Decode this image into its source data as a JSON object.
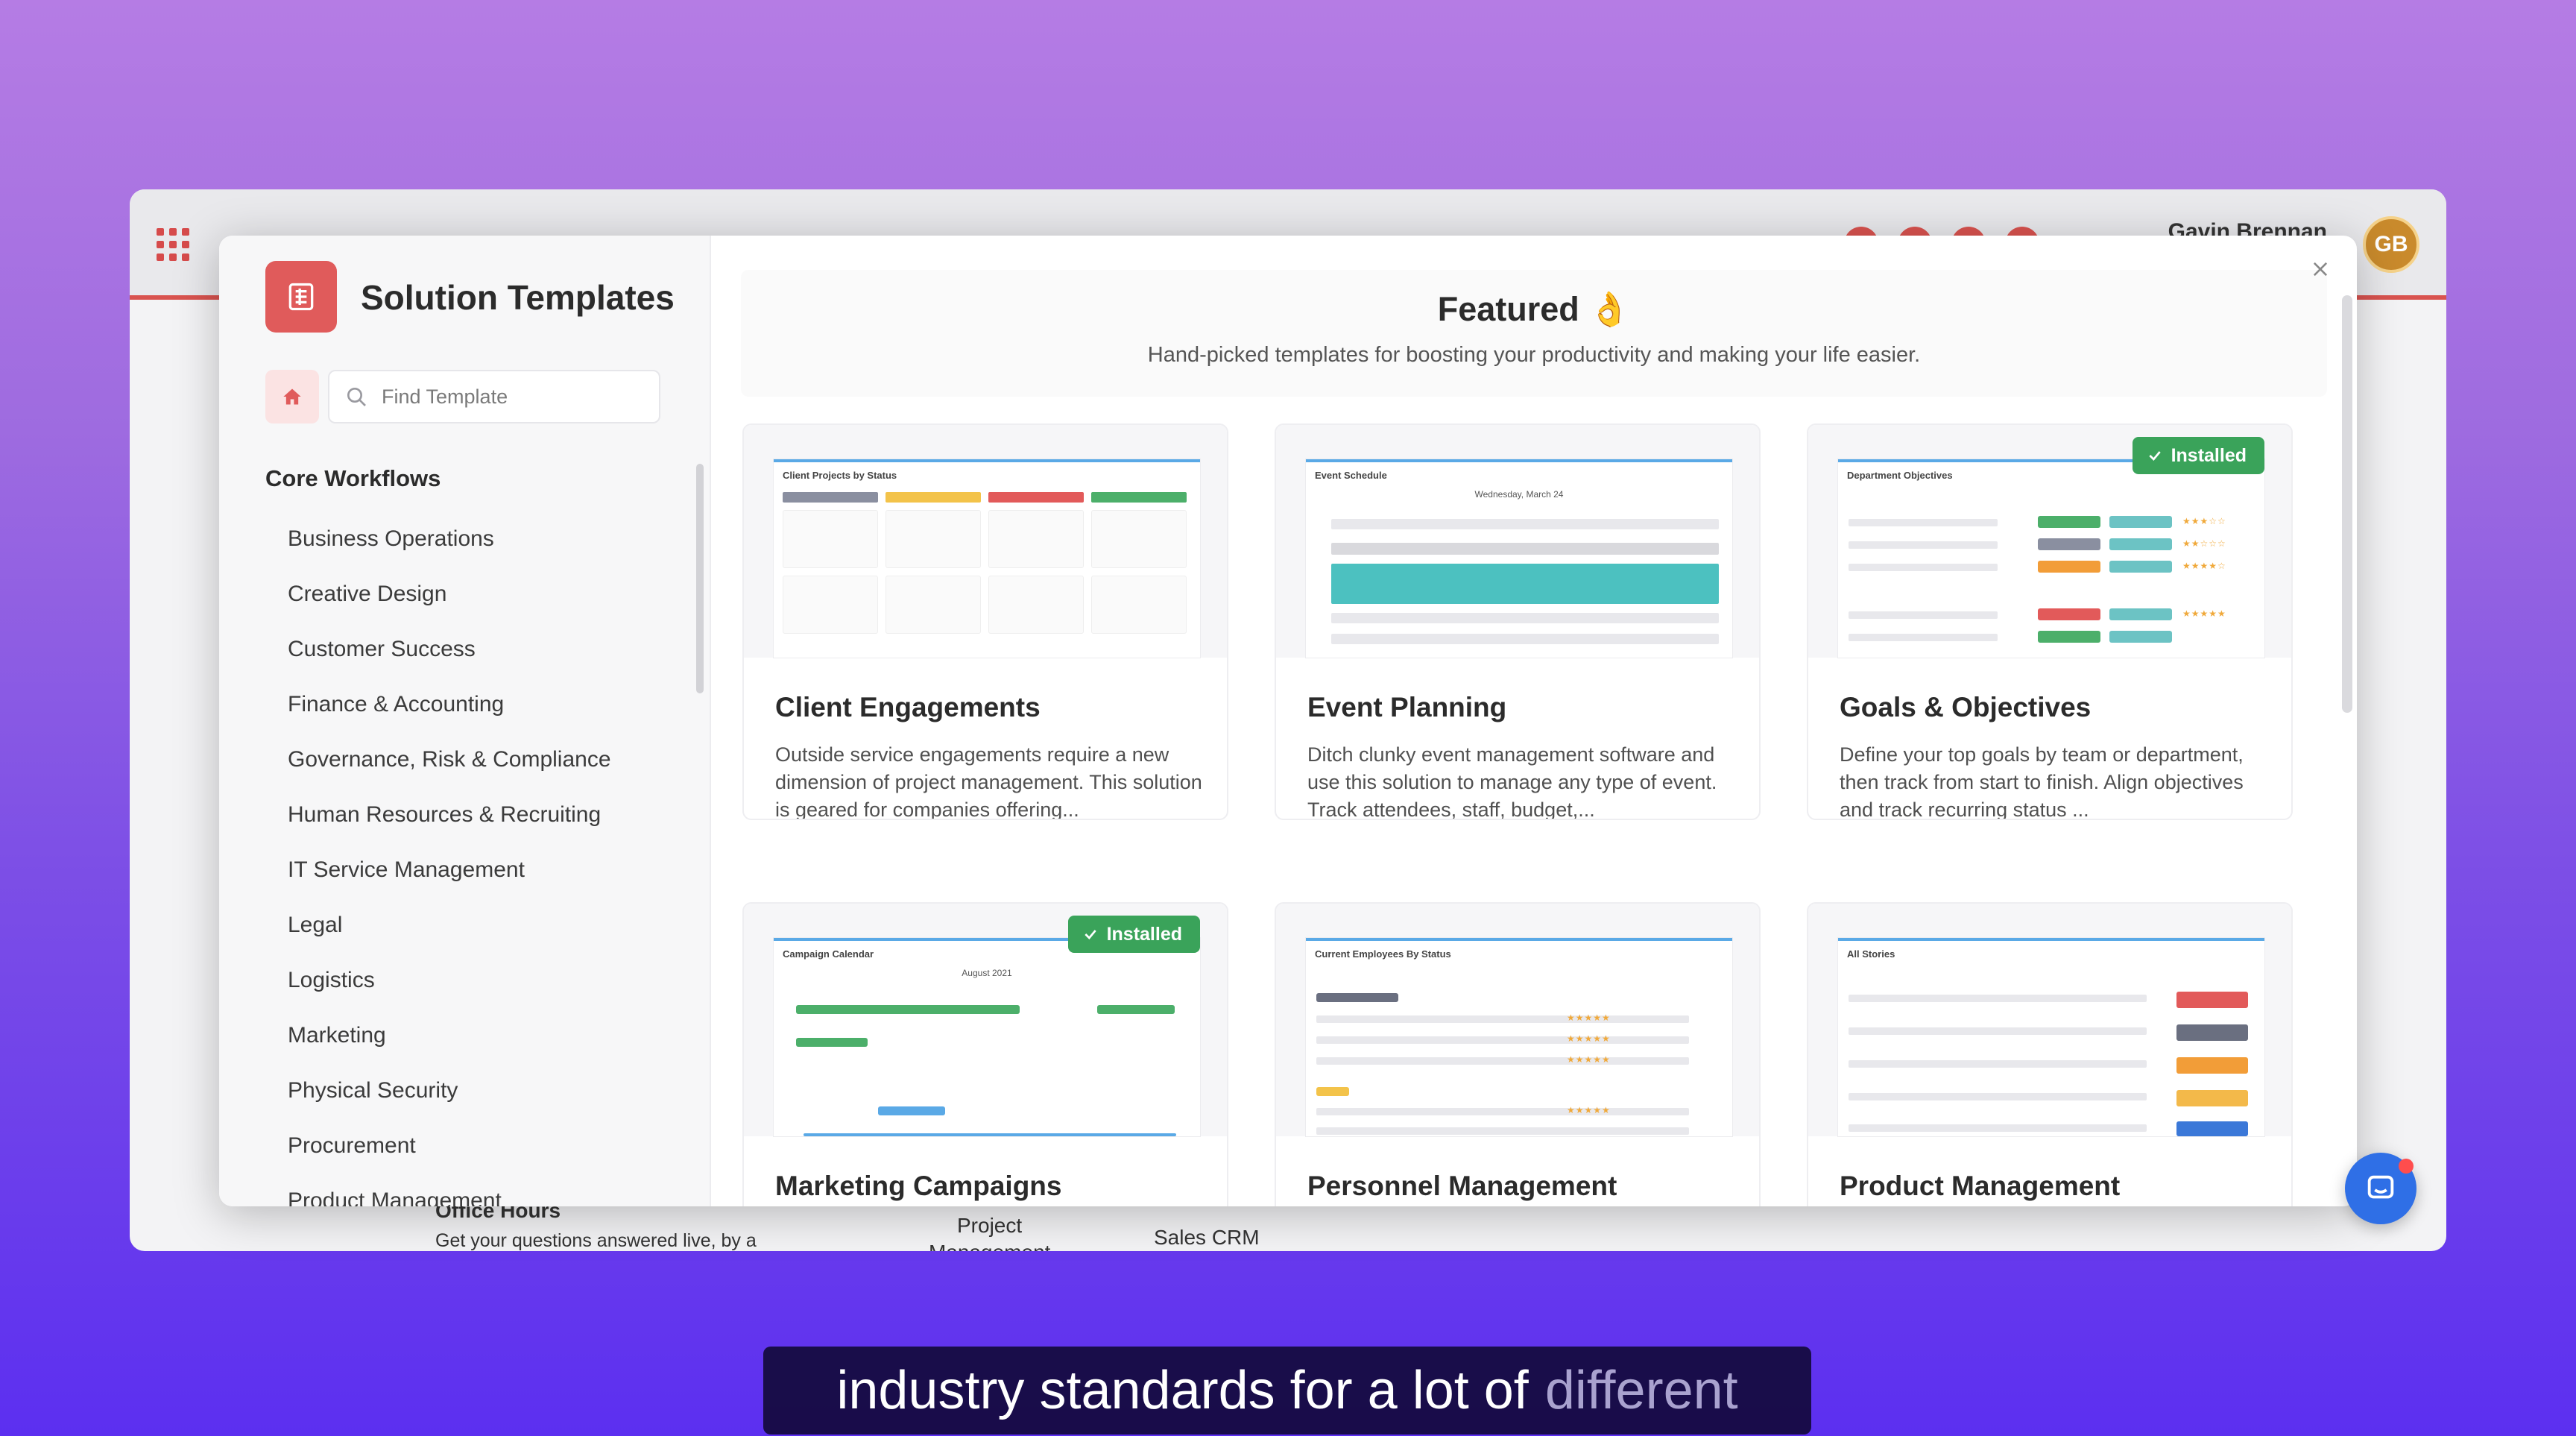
{
  "background_app": {
    "user_name": "Gavin Brennan",
    "avatar_initials": "GB",
    "bottom_texts": {
      "office_hours": "Office Hours",
      "office_hours_desc": "Get your questions answered live, by a",
      "project": "Project",
      "project_sub": "Management",
      "sales_crm": "Sales CRM"
    }
  },
  "modal": {
    "title": "Solution Templates",
    "search": {
      "placeholder": "Find Template",
      "value": ""
    },
    "section_title": "Core Workflows",
    "categories": [
      "Business Operations",
      "Creative Design",
      "Customer Success",
      "Finance & Accounting",
      "Governance, Risk & Compliance",
      "Human Resources & Recruiting",
      "IT Service Management",
      "Legal",
      "Logistics",
      "Marketing",
      "Physical Security",
      "Procurement",
      "Product Management"
    ],
    "featured": {
      "title": "Featured 👌",
      "subtitle": "Hand-picked templates for boosting your productivity and making your life easier."
    },
    "installed_label": "Installed",
    "cards": [
      {
        "title": "Client Engagements",
        "description": "Outside service engagements require a new dimension of project management. This solution is geared for companies offering...",
        "thumb_label": "Client Projects by Status",
        "installed": false
      },
      {
        "title": "Event Planning",
        "description": "Ditch clunky event management software and use this solution to manage any type of event. Track attendees, staff, budget,...",
        "thumb_label": "Event Schedule",
        "thumb_sub": "Wednesday, March 24",
        "installed": false
      },
      {
        "title": "Goals & Objectives",
        "description": "Define your top goals by team or department, then track from start to finish. Align objectives and track recurring status ...",
        "thumb_label": "Department Objectives",
        "installed": true
      },
      {
        "title": "Marketing Campaigns",
        "description": "",
        "thumb_label": "Campaign Calendar",
        "thumb_sub": "August 2021",
        "installed": true
      },
      {
        "title": "Personnel Management",
        "description": "",
        "thumb_label": "Current Employees By Status",
        "installed": false
      },
      {
        "title": "Product Management",
        "description": "",
        "thumb_label": "All Stories",
        "installed": false
      }
    ]
  },
  "caption": {
    "text": "industry standards for a lot of",
    "dim_text": "different"
  },
  "colors": {
    "accent_red": "#e05b5b",
    "installed_green": "#3aa35a",
    "chat_blue": "#2f6fe6"
  }
}
